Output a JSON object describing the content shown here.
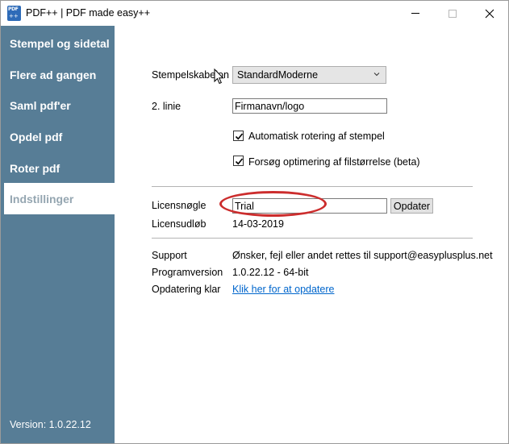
{
  "window": {
    "title": "PDF++ | PDF made easy++",
    "icon_text": "PDF"
  },
  "sidebar": {
    "items": [
      {
        "label": "Stempel og sidetal",
        "active": false
      },
      {
        "label": "Flere ad gangen",
        "active": false
      },
      {
        "label": "Saml pdf'er",
        "active": false
      },
      {
        "label": "Opdel pdf",
        "active": false
      },
      {
        "label": "Roter pdf",
        "active": false
      },
      {
        "label": "Indstillinger",
        "active": true
      }
    ],
    "version": "Version: 1.0.22.12"
  },
  "settings": {
    "stamp_template_label": "Stempelskabelon",
    "stamp_template_value": "StandardModerne",
    "second_line_label": "2. linie",
    "second_line_value": "Firmanavn/logo",
    "auto_rotate_label": "Automatisk rotering af stempel",
    "auto_rotate_checked": true,
    "optimize_label": "Forsøg optimering af filstørrelse (beta)",
    "optimize_checked": true
  },
  "license": {
    "key_label": "Licensnøgle",
    "key_value": "Trial",
    "update_button": "Opdater",
    "expiry_label": "Licensudløb",
    "expiry_value": "14-03-2019"
  },
  "about": {
    "support_label": "Support",
    "support_value": "Ønsker, fejl eller andet rettes til support@easyplusplus.net",
    "version_label": "Programversion",
    "version_value": "1.0.22.12 - 64-bit",
    "update_label": "Opdatering klar",
    "update_link": "Klik her for at opdatere"
  },
  "colors": {
    "sidebar_bg": "#577d96",
    "active_nav_text": "#95a6b1",
    "link": "#0066cc",
    "annotation_ring": "#cc2d2d"
  }
}
